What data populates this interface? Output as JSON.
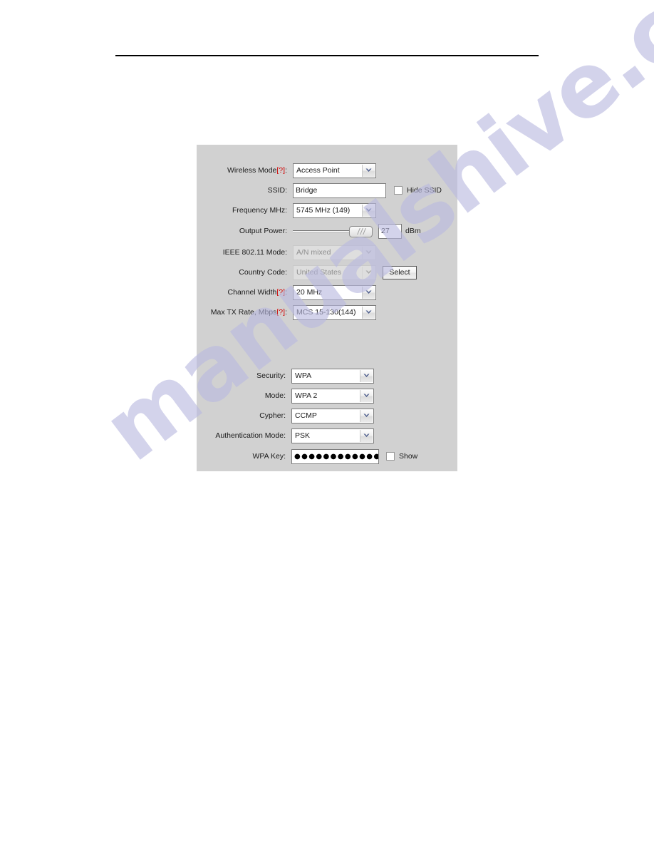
{
  "page": {
    "watermark_text": "manualshive.com",
    "watermark_color": "#b9b9e0",
    "panel_background": "#d1d1d1",
    "hint_marker": "[?]",
    "hint_color": "#d00000"
  },
  "wireless_settings": {
    "rows": [
      {
        "id": "wireless-mode",
        "label": "Wireless Mode",
        "has_hint": true,
        "colon": ":",
        "control": "select",
        "value": "Access Point",
        "disabled": false
      },
      {
        "id": "ssid",
        "label": "SSID",
        "has_hint": false,
        "colon": ":",
        "control": "text",
        "value": "Bridge",
        "disabled": false,
        "checkbox_label": "Hide SSID",
        "checkbox_checked": false
      },
      {
        "id": "frequency-mhz",
        "label": "Frequency MHz",
        "has_hint": false,
        "colon": ":",
        "control": "select",
        "value": "5745 MHz (149)",
        "disabled": false
      },
      {
        "id": "output-power",
        "label": "Output Power",
        "has_hint": false,
        "colon": ":",
        "control": "slider",
        "value": "27",
        "unit": "dBm",
        "disabled": false
      },
      {
        "id": "ieee-80211-mode",
        "label": "IEEE 802.11 Mode",
        "has_hint": false,
        "colon": ":",
        "control": "select",
        "value": "A/N mixed",
        "disabled": true
      },
      {
        "id": "country-code",
        "label": "Country Code",
        "has_hint": false,
        "colon": ":",
        "control": "select",
        "value": "United States",
        "disabled": true,
        "button_label": "Select"
      },
      {
        "id": "channel-width",
        "label": "Channel Width",
        "has_hint": true,
        "colon": ":",
        "control": "select",
        "value": "20 MHz",
        "disabled": false
      },
      {
        "id": "max-tx-rate",
        "label": "Max TX Rate, Mbps",
        "has_hint": true,
        "colon": ":",
        "control": "select",
        "value": "MCS 15-130(144)",
        "disabled": false
      }
    ]
  },
  "security_settings": {
    "rows": [
      {
        "id": "security",
        "label": "Security",
        "has_hint": false,
        "colon": ":",
        "control": "select",
        "value": "WPA",
        "disabled": false
      },
      {
        "id": "mode",
        "label": "Mode",
        "has_hint": false,
        "colon": ":",
        "control": "select",
        "value": "WPA 2",
        "disabled": false
      },
      {
        "id": "cypher",
        "label": "Cypher",
        "has_hint": false,
        "colon": ":",
        "control": "select",
        "value": "CCMP",
        "disabled": false
      },
      {
        "id": "authentication-mode",
        "label": "Authentication Mode",
        "has_hint": false,
        "colon": ":",
        "control": "select",
        "value": "PSK",
        "disabled": false
      },
      {
        "id": "wpa-key",
        "label": "WPA Key",
        "has_hint": false,
        "colon": ":",
        "control": "password",
        "value": "●●●●●●●●●●●●●",
        "disabled": false,
        "checkbox_label": "Show",
        "checkbox_checked": false
      }
    ]
  }
}
